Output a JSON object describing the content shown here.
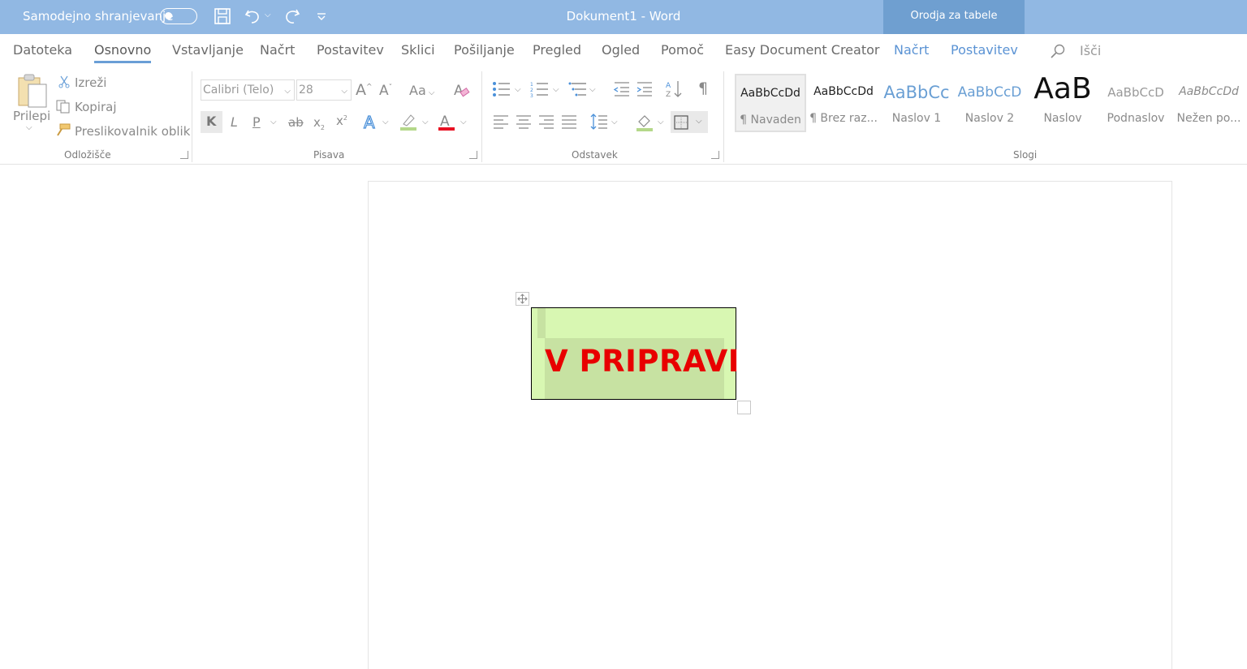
{
  "titlebar": {
    "autosave_label": "Samodejno shranjevanje",
    "doc_title": "Dokument1  -  Word",
    "context_group": "Orodja za tabele"
  },
  "tabs": [
    {
      "label": "Datoteka"
    },
    {
      "label": "Osnovno"
    },
    {
      "label": "Vstavljanje"
    },
    {
      "label": "Načrt"
    },
    {
      "label": "Postavitev"
    },
    {
      "label": "Sklici"
    },
    {
      "label": "Pošiljanje"
    },
    {
      "label": "Pregled"
    },
    {
      "label": "Ogled"
    },
    {
      "label": "Pomoč"
    },
    {
      "label": "Easy Document Creator"
    },
    {
      "label": "Načrt"
    },
    {
      "label": "Postavitev"
    }
  ],
  "search": {
    "label": "Išči"
  },
  "clipboard": {
    "paste": "Prilepi",
    "cut": "Izreži",
    "copy": "Kopiraj",
    "format_painter": "Preslikovalnik oblik",
    "group": "Odložišče"
  },
  "font": {
    "family": "Calibri (Telo)",
    "size": "28",
    "change_case": "Aa",
    "bold": "K",
    "italic": "L",
    "underline": "P",
    "strike": "ab",
    "group": "Pisava",
    "color_accent": "#e81123",
    "highlight_accent": "#b4d88a"
  },
  "paragraph": {
    "group": "Odstavek"
  },
  "styles": {
    "group": "Slogi",
    "items": [
      {
        "preview": "AaBbCcDd",
        "name": "¶ Navaden"
      },
      {
        "preview": "AaBbCcDd",
        "name": "¶ Brez raz..."
      },
      {
        "preview": "AaBbCc",
        "name": "Naslov 1"
      },
      {
        "preview": "AaBbCcD",
        "name": "Naslov 2"
      },
      {
        "preview": "AaB",
        "name": "Naslov"
      },
      {
        "preview": "AaBbCcD",
        "name": "Podnaslov"
      },
      {
        "preview": "AaBbCcDd",
        "name": "Nežen po..."
      }
    ]
  },
  "document": {
    "cell_text": "V PRIPRAVI",
    "cell_color": "#d8f7b2",
    "text_color": "#e80000"
  }
}
